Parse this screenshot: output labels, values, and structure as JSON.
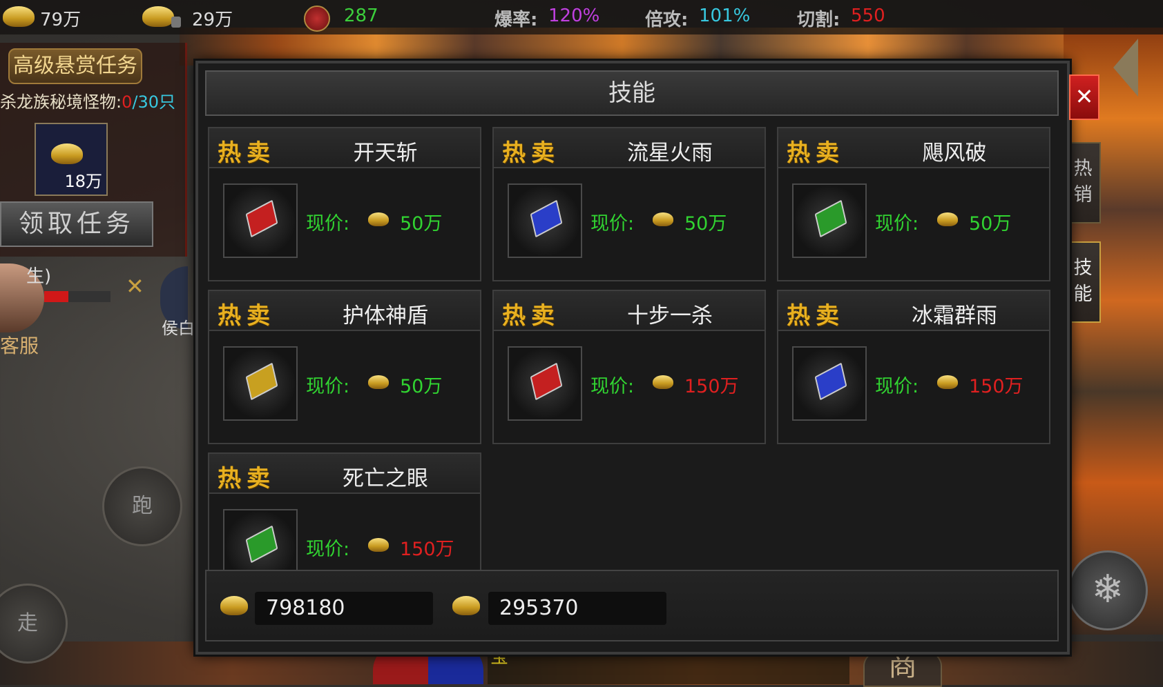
{
  "hud": {
    "gold": "79万",
    "bound_gold": "29万",
    "points": "287",
    "drop_rate_label": "爆率:",
    "drop_rate_value": "120%",
    "multi_attack_label": "倍攻:",
    "multi_attack_value": "101%",
    "cut_label": "切割:",
    "cut_value": "550"
  },
  "bounty": {
    "title": "高级悬赏任务",
    "task_prefix": "杀龙族秘境怪物:",
    "task_progress": "0",
    "task_total": "/30只",
    "reward_amount": "18万",
    "claim_label": "领取任务"
  },
  "player": {
    "customer_service": "客服",
    "target_name": "侯白",
    "label_fragment": "生)",
    "run_label": "跑",
    "walk_label": "走"
  },
  "modal": {
    "title": "技能",
    "close_symbol": "✕",
    "hot_label": "热卖",
    "price_label": "现价:",
    "skills": [
      {
        "name": "开天斩",
        "price": "50万",
        "price_color": "#31d431",
        "book_color": "#c42020"
      },
      {
        "name": "流星火雨",
        "price": "50万",
        "price_color": "#31d431",
        "book_color": "#2a3ec8"
      },
      {
        "name": "飓风破",
        "price": "50万",
        "price_color": "#31d431",
        "book_color": "#2a9a2a"
      },
      {
        "name": "护体神盾",
        "price": "50万",
        "price_color": "#31d431",
        "book_color": "#c8a020"
      },
      {
        "name": "十步一杀",
        "price": "150万",
        "price_color": "#e02020",
        "book_color": "#c42020"
      },
      {
        "name": "冰霜群雨",
        "price": "150万",
        "price_color": "#e02020",
        "book_color": "#2a3ec8"
      },
      {
        "name": "死亡之眼",
        "price": "150万",
        "price_color": "#e02020",
        "book_color": "#2a9a2a"
      }
    ],
    "gold_balance": "798180",
    "bound_gold_balance": "295370"
  },
  "side_tabs": {
    "hot_sale": "热销",
    "skills": "技能"
  },
  "bottom": {
    "shop_label": "商",
    "chat_fragment": "宝"
  }
}
